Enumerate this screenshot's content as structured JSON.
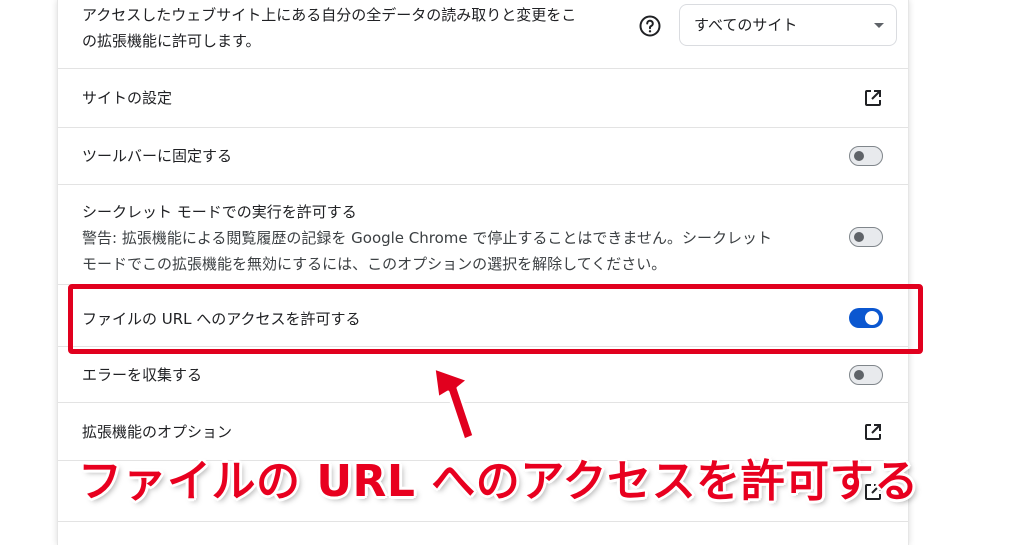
{
  "site_access": {
    "label_line1": "アクセスしたウェブサイト上にある自分の全データの読み取りと変更をこ",
    "label_line2": "の拡張機能に許可します。",
    "select_value": "すべてのサイト"
  },
  "rows": {
    "site_settings": "サイトの設定",
    "pin_toolbar": "ツールバーに固定する",
    "incognito_title": "シークレット モードでの実行を許可する",
    "incognito_warning": "警告: 拡張機能による閲覧履歴の記録を Google Chrome で停止することはできません。シークレット\nモードでこの拡張機能を無効にするには、このオプションの選択を解除してください。",
    "file_url_access": "ファイルの URL へのアクセスを許可する",
    "collect_errors": "エラーを収集する",
    "extension_options": "拡張機能のオプション"
  },
  "toggles": {
    "pin_toolbar": false,
    "incognito": false,
    "file_url_access": true,
    "collect_errors": false
  },
  "annotation": {
    "callout_text": "ファイルの URL へのアクセスを許可する",
    "color": "#e1001e"
  },
  "colors": {
    "toggle_on": "#0b57d0"
  }
}
